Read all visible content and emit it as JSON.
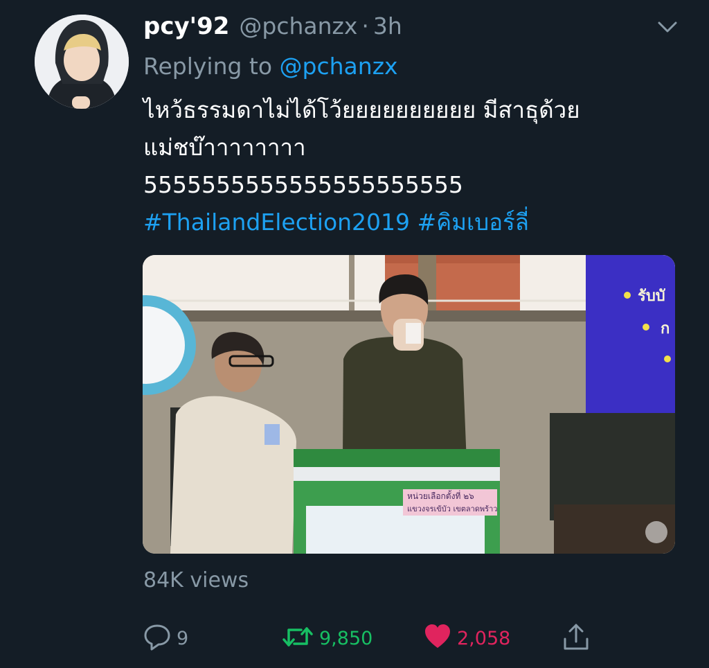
{
  "tweet": {
    "display_name": "pcy'92",
    "handle": "@pchanzx",
    "separator": "·",
    "time": "3h",
    "reply_prefix": "Replying to",
    "reply_mention": "@pchanzx",
    "text_lines": [
      "ไหว้ธรรมดาไม่ได้โว้ยยยยยยยยยย มีสาธุด้วย",
      "แม่ชบ๊าาาาาาาา",
      "5555555555555555555555"
    ],
    "hashtags": [
      "#ThailandElection2019",
      "#คิมเบอร์ลี่"
    ],
    "views": "84K views"
  },
  "media": {
    "ballot_label_line1": "หน่วยเลือกตั้งที่  ๒๖",
    "ballot_label_line2": "แขวงจรเข้บัว เขตลาดพร้าว",
    "banner_text_1": "รับบั",
    "banner_text_2": "ก"
  },
  "actions": {
    "reply_count": "9",
    "retweet_count": "9,850",
    "like_count": "2,058"
  },
  "icons": {
    "chevron": "chevron-down-icon",
    "reply": "reply-icon",
    "retweet": "retweet-icon",
    "like": "heart-icon",
    "share": "share-icon"
  },
  "colors": {
    "background": "#141d26",
    "link_blue": "#1da1f2",
    "secondary_text": "#8899a6",
    "retweet_green": "#17bf63",
    "like_red": "#e0245e"
  }
}
